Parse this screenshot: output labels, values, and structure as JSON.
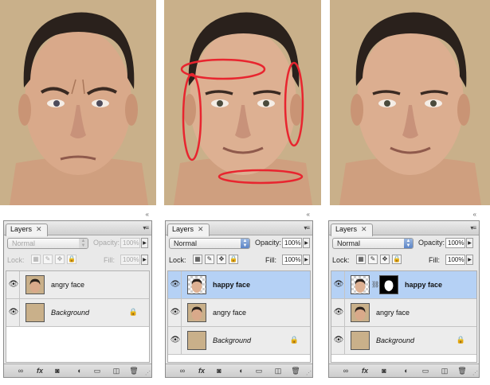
{
  "colors": {
    "backdrop": "#c9b08a",
    "skin": "#d7a987",
    "hair": "#2a211c",
    "highlight": "#e8252f",
    "selected_row": "#b5d1f5"
  },
  "panels": [
    {
      "tab_label": "Layers",
      "close_glyph": "✕",
      "blend_mode": "Normal",
      "opacity_label": "Opacity:",
      "opacity_value": "100%",
      "lock_label": "Lock:",
      "fill_label": "Fill:",
      "fill_value": "100%",
      "layers": [
        {
          "name": "angry face",
          "visible": true,
          "selected": false
        },
        {
          "name": "Background",
          "visible": true,
          "selected": false,
          "locked": true
        }
      ]
    },
    {
      "tab_label": "Layers",
      "close_glyph": "✕",
      "blend_mode": "Normal",
      "opacity_label": "Opacity:",
      "opacity_value": "100%",
      "lock_label": "Lock:",
      "fill_label": "Fill:",
      "fill_value": "100%",
      "layers": [
        {
          "name": "happy face",
          "visible": true,
          "selected": true
        },
        {
          "name": "angry face",
          "visible": true,
          "selected": false
        },
        {
          "name": "Background",
          "visible": true,
          "selected": false,
          "locked": true
        }
      ]
    },
    {
      "tab_label": "Layers",
      "close_glyph": "✕",
      "blend_mode": "Normal",
      "opacity_label": "Opacity:",
      "opacity_value": "100%",
      "lock_label": "Lock:",
      "fill_label": "Fill:",
      "fill_value": "100%",
      "layers": [
        {
          "name": "happy face",
          "visible": true,
          "selected": true,
          "has_mask": true
        },
        {
          "name": "angry face",
          "visible": true,
          "selected": false
        },
        {
          "name": "Background",
          "visible": true,
          "selected": false,
          "locked": true
        }
      ]
    }
  ],
  "bottom_bar_icons": [
    "link-layers-icon",
    "fx-icon",
    "add-mask-icon",
    "adjustment-layer-icon",
    "new-group-icon",
    "new-layer-icon",
    "trash-icon"
  ],
  "bottom_bar_glyphs": {
    "fx": "fx"
  }
}
